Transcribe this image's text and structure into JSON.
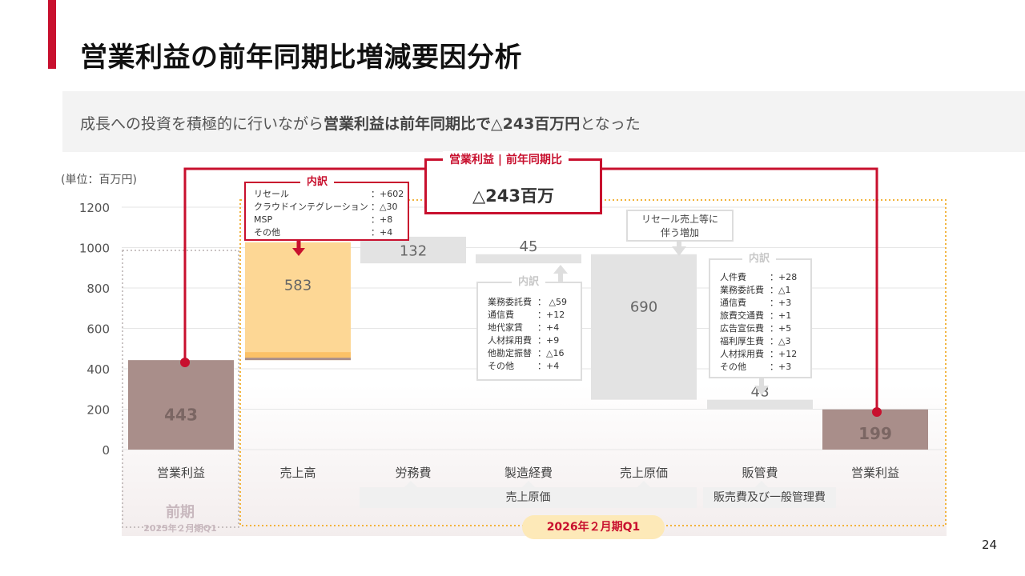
{
  "title": "営業利益の前年同期比増減要因分析",
  "subtitle": {
    "pre": "成長への投資を積極的に行いながら",
    "bold": "営業利益は前年同期比で△243百万円",
    "post": "となった"
  },
  "unit_label": "(単位：百万円)",
  "summary": {
    "header": "営業利益 | 前年同期比",
    "value": "△243百万"
  },
  "callout_cost": {
    "line1": "リセール売上等に",
    "line2": "伴う増加"
  },
  "breakdown_sales": {
    "header": "内訳",
    "items": [
      {
        "name": "リセール",
        "value": "：+602"
      },
      {
        "name": "クラウドインテグレーション",
        "value": "：△30"
      },
      {
        "name": "MSP",
        "value": "：+8"
      },
      {
        "name": "その他",
        "value": "：+4"
      }
    ]
  },
  "breakdown_mfg": {
    "header": "内訳",
    "items": [
      {
        "name": "業務委託費",
        "value": "： △59"
      },
      {
        "name": "通信費",
        "value": "：+12"
      },
      {
        "name": "地代家賃",
        "value": "：+4"
      },
      {
        "name": "人材採用費",
        "value": "：+9"
      },
      {
        "name": "他勘定振替",
        "value": "：△16"
      },
      {
        "name": "その他",
        "value": "：+4"
      }
    ]
  },
  "breakdown_sga": {
    "header": "内訳",
    "items": [
      {
        "name": "人件費",
        "value": "：+28"
      },
      {
        "name": "業務委託費",
        "value": "：△1"
      },
      {
        "name": "通信費",
        "value": "：+3"
      },
      {
        "name": "旅費交通費",
        "value": "：+1"
      },
      {
        "name": "広告宣伝費",
        "value": "：+5"
      },
      {
        "name": "福利厚生費",
        "value": "：△3"
      },
      {
        "name": "人材採用費",
        "value": "：+12"
      },
      {
        "name": "その他",
        "value": "：+3"
      }
    ]
  },
  "groups": {
    "cost_of_sales": "売上原価",
    "sga": "販売費及び一般管理費"
  },
  "prev_period": {
    "label": "前期",
    "sub": "2025年２月期Q1"
  },
  "current_period": "2026年２月期Q1",
  "page_number": "24",
  "colors": {
    "accent": "#c8102e",
    "op_bar": "#a98e8a",
    "sales_bar": "#fdd795",
    "sales_bar_dark": "#fbc167",
    "cost_bar": "#e3e3e3",
    "period_frame": "#f2b43c"
  },
  "chart_data": {
    "type": "bar",
    "subtype": "waterfall",
    "ylim": [
      0,
      1200
    ],
    "yticks": [
      "0",
      "200",
      "400",
      "600",
      "800",
      "1000",
      "1200"
    ],
    "categories": [
      "営業利益",
      "売上高",
      "労務費",
      "製造経費",
      "売上原価",
      "販管費",
      "営業利益"
    ],
    "bars": [
      {
        "label": "443",
        "base": 0,
        "top": 443,
        "kind": "total"
      },
      {
        "label": "583",
        "base": 443,
        "top": 1026,
        "kind": "increase"
      },
      {
        "label": "132",
        "base": 922,
        "top": 1054,
        "kind": "decrease"
      },
      {
        "label": "45",
        "base": 922,
        "top": 967,
        "kind": "decrease"
      },
      {
        "label": "690",
        "base": 247,
        "top": 967,
        "kind": "decrease"
      },
      {
        "label": "48",
        "base": 199,
        "top": 247,
        "kind": "decrease"
      },
      {
        "label": "199",
        "base": 0,
        "top": 199,
        "kind": "total"
      }
    ]
  }
}
